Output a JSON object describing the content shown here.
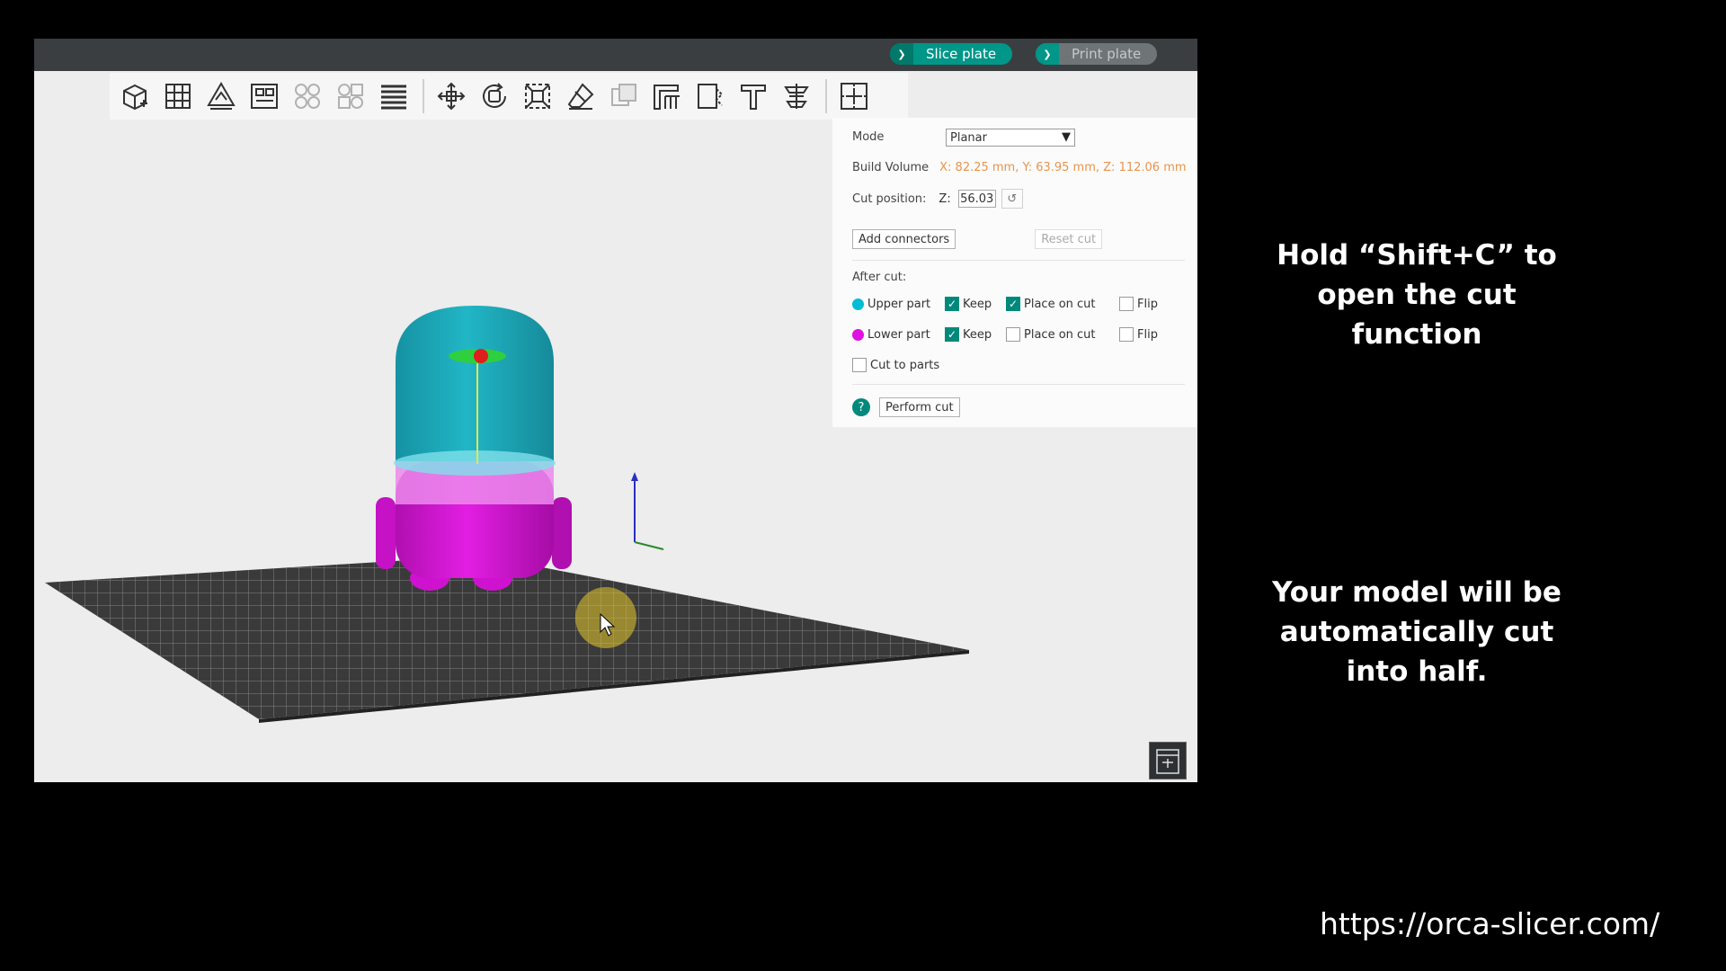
{
  "topbar": {
    "slice_label": "Slice plate",
    "print_label": "Print plate"
  },
  "toolbar": {
    "tools": [
      "add-cube-icon",
      "grid-arrange-icon",
      "orient-icon",
      "layout-icon",
      "split-objects-icon",
      "split-parts-icon",
      "layers-icon",
      "move-icon",
      "rotate-icon",
      "scale-icon",
      "erase-icon",
      "boolean-icon",
      "support-paint-icon",
      "seam-paint-icon",
      "text-icon",
      "measure-icon",
      "assembly-icon"
    ]
  },
  "cut_panel": {
    "mode_label": "Mode",
    "mode_value": "Planar",
    "build_volume_label": "Build Volume",
    "build_volume_value": "X: 82.25 mm,  Y: 63.95 mm,  Z: 112.06 mm",
    "cut_position_label": "Cut position:",
    "cut_axis": "Z:",
    "cut_value": "56.03",
    "add_connectors": "Add connectors",
    "reset_cut": "Reset cut",
    "after_cut_label": "After cut:",
    "upper_part": "Upper part",
    "lower_part": "Lower part",
    "keep": "Keep",
    "place_on_cut": "Place on cut",
    "flip": "Flip",
    "cut_to_parts": "Cut to parts",
    "help": "?",
    "perform_cut": "Perform cut",
    "upper_color": "#00bcd4",
    "lower_color": "#e010e0"
  },
  "captions": {
    "line1": "Hold “Shift+C” to open the cut function",
    "line2": "Your model will be automatically cut into half."
  },
  "url": "https://orca-slicer.com/"
}
